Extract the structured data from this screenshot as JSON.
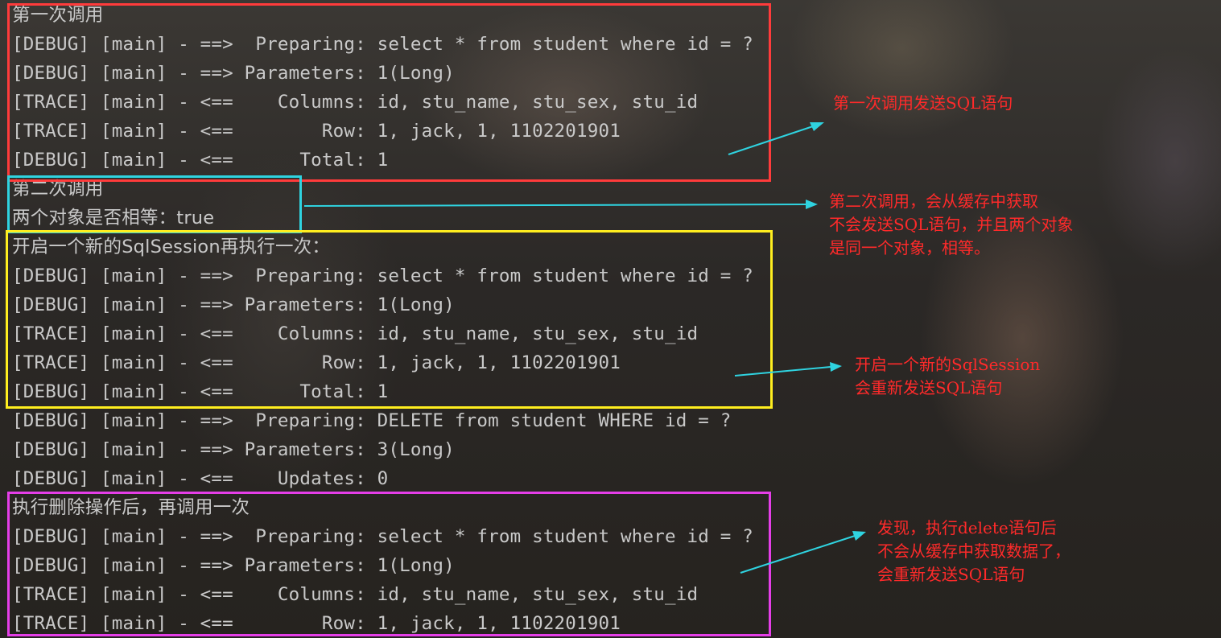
{
  "console": {
    "lines": [
      "第一次调用",
      "[DEBUG] [main] - ==>  Preparing: select * from student where id = ?",
      "[DEBUG] [main] - ==> Parameters: 1(Long)",
      "[TRACE] [main] - <==    Columns: id, stu_name, stu_sex, stu_id",
      "[TRACE] [main] - <==        Row: 1, jack, 1, 1102201901",
      "[DEBUG] [main] - <==      Total: 1",
      "第二次调用",
      "两个对象是否相等：true",
      "开启一个新的SqlSession再执行一次：",
      "[DEBUG] [main] - ==>  Preparing: select * from student where id = ?",
      "[DEBUG] [main] - ==> Parameters: 1(Long)",
      "[TRACE] [main] - <==    Columns: id, stu_name, stu_sex, stu_id",
      "[TRACE] [main] - <==        Row: 1, jack, 1, 1102201901",
      "[DEBUG] [main] - <==      Total: 1",
      "[DEBUG] [main] - ==>  Preparing: DELETE from student WHERE id = ?",
      "[DEBUG] [main] - ==> Parameters: 3(Long)",
      "[DEBUG] [main] - <==    Updates: 0",
      "执行删除操作后，再调用一次",
      "[DEBUG] [main] - ==>  Preparing: select * from student where id = ?",
      "[DEBUG] [main] - ==> Parameters: 1(Long)",
      "[TRACE] [main] - <==    Columns: id, stu_name, stu_sex, stu_id",
      "[TRACE] [main] - <==        Row: 1, jack, 1, 1102201901"
    ]
  },
  "annotations": {
    "note1": "第一次调用发送SQL语句",
    "note2": "第二次调用，会从缓存中获取\n不会发送SQL语句，并且两个对象\n是同一个对象，相等。",
    "note3": "开启一个新的SqlSession\n会重新发送SQL语句",
    "note4": "发现，执行delete语句后\n不会从缓存中获取数据了，\n会重新发送SQL语句"
  },
  "colors": {
    "box_first_call": "#ff3b3b",
    "box_second_call": "#2fd3e0",
    "box_new_session": "#ffee1f",
    "box_after_delete": "#e53ee8",
    "arrow": "#2fd3e0",
    "note_text": "#ff2a2a",
    "console_text": "#c9c9c9"
  }
}
